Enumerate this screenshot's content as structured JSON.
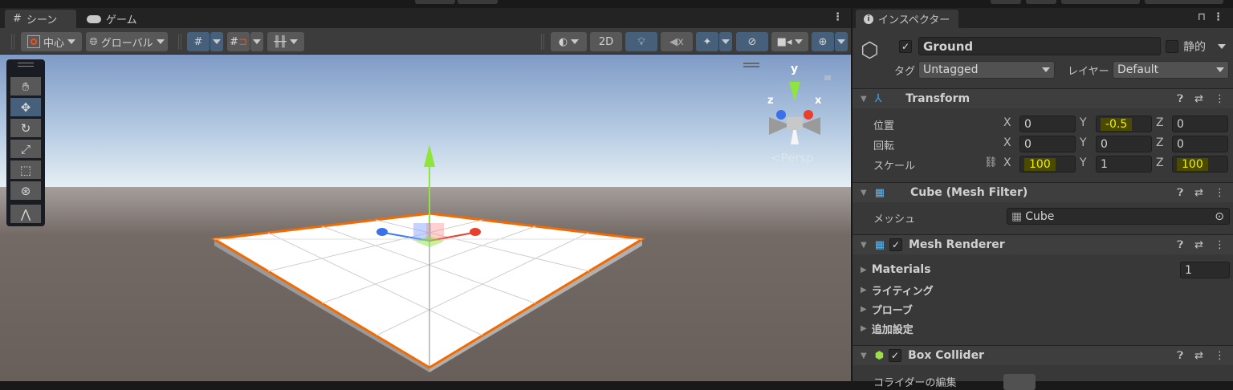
{
  "scene_tabs": [
    {
      "label": "シーン",
      "icon": "grid-icon"
    },
    {
      "label": "ゲーム",
      "icon": "gamepad-icon"
    }
  ],
  "scene_toolbar": {
    "pivot": "中心",
    "space": "グローバル",
    "mode_2d": "2D"
  },
  "viewport": {
    "persp_label": "Persp",
    "gizmo_axes": {
      "x": "x",
      "y": "y",
      "z": "z"
    },
    "sky_color": "#7f9bc6",
    "ground_color": "#6d6561",
    "selection_color": "#f26a00"
  },
  "inspector": {
    "tab": "インスペクター",
    "object": {
      "active": true,
      "name": "Ground",
      "static_label": "静的",
      "static": false,
      "tag_label": "タグ",
      "tag": "Untagged",
      "layer_label": "レイヤー",
      "layer": "Default"
    },
    "transform": {
      "title": "Transform",
      "rows": [
        {
          "label": "位置",
          "x": "0",
          "y": "-0.5",
          "z": "0"
        },
        {
          "label": "回転",
          "x": "0",
          "y": "0",
          "z": "0"
        },
        {
          "label": "スケール",
          "x": "100",
          "y": "1",
          "z": "100"
        }
      ],
      "axis_x": "X",
      "axis_y": "Y",
      "axis_z": "Z"
    },
    "mesh_filter": {
      "title": "Cube (Mesh Filter)",
      "mesh_label": "メッシュ",
      "mesh": "Cube"
    },
    "mesh_renderer": {
      "title": "Mesh Renderer",
      "enabled": true,
      "materials_label": "Materials",
      "materials_count": "1",
      "sections": [
        "ライティング",
        "プローブ",
        "追加設定"
      ]
    },
    "box_collider": {
      "title": "Box Collider",
      "enabled": true,
      "edit_label": "コライダーの編集"
    }
  }
}
